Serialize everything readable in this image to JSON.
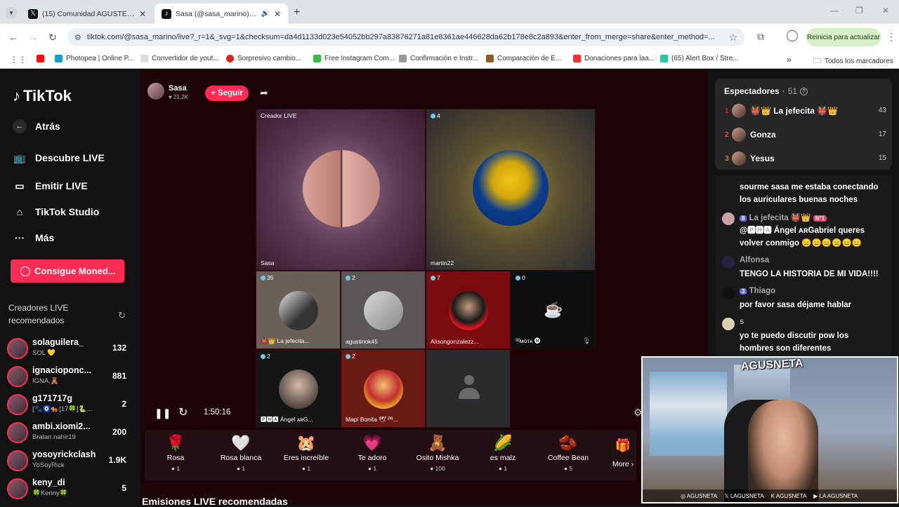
{
  "browser": {
    "tabs": [
      {
        "title": "(15) Comunidad AGUSTETISMO",
        "active": false
      },
      {
        "title": "Sasa (@sasa_marino) está en",
        "active": true
      }
    ],
    "url": "tiktok.com/@sasa_marino/live?_r=1&_svg=1&checksum=da4d1133d023e54052bb297a83876271a81e8361ae446628da62b178e8c2a893&enter_from_merge=share&enter_method=...",
    "update_button": "Reinicia para actualizar",
    "bookmarks": [
      "Photopea | Online P...",
      "Convertidor de yout...",
      "Sorpresivo cambio...",
      "Free Instagram Com...",
      "Confirmación e Instr...",
      "Comparación de E...",
      "Donaciones para laa...",
      "(65) Alert Box / Stre..."
    ],
    "all_bookmarks": "Todos los marcadores"
  },
  "sidebar": {
    "logo": "TikTok",
    "nav": [
      {
        "label": "Atrás",
        "icon": "arrow-left-icon"
      },
      {
        "label": "Descubre LIVE",
        "icon": "tv-icon"
      },
      {
        "label": "Emitir LIVE",
        "icon": "camera-icon"
      },
      {
        "label": "TikTok Studio",
        "icon": "studio-icon"
      },
      {
        "label": "Más",
        "icon": "more-icon"
      }
    ],
    "coins_button": "Consigue Moned...",
    "recommended_title": "Creadores LIVE recomendados",
    "creators": [
      {
        "name": "solaguilera_",
        "sub": "SOL 💛",
        "count": "132"
      },
      {
        "name": "ignacioponc...",
        "sub": "IGNA.🧸",
        "count": "881"
      },
      {
        "name": "g171717g",
        "sub": "[🐾🧿🐅[17🍀]🐍...",
        "count": "2"
      },
      {
        "name": "ambi.xiomi2...",
        "sub": "Bralan.nahir19",
        "count": "200"
      },
      {
        "name": "yosoyrickclash",
        "sub": "YoSoyRick",
        "count": "1.9K"
      },
      {
        "name": "keny_di",
        "sub": "🍀Kenny🍀",
        "count": "5"
      }
    ]
  },
  "stage": {
    "host_name": "Sasa",
    "host_likes": "♥ 21.2K",
    "follow_label": "+ Seguir",
    "cells": {
      "main_label": "Creador LIVE",
      "main_name": "Sasa",
      "second_count": "4",
      "second_name": "martin22",
      "row2": [
        {
          "count": "35",
          "name": "👹👑 La jefecita..."
        },
        {
          "count": "2",
          "name": "agustinok45"
        },
        {
          "count": "7",
          "name": "Alisongonzalezz..."
        },
        {
          "count": "0",
          "name": "³²ᴍᴏᴛᴀ 🅜"
        }
      ],
      "row3": [
        {
          "count": "2",
          "name": "🅿🅷🅰 Ángel ᴀʀG..."
        },
        {
          "count": "2",
          "name": "Mapi Bonita 🕊 ᴾᴿ..."
        }
      ]
    },
    "timer": "1:50:16",
    "gifts": [
      {
        "name": "Rosa",
        "price": "1",
        "icon": "🌹"
      },
      {
        "name": "Rosa blanca",
        "price": "1",
        "icon": "🤍"
      },
      {
        "name": "Eres increíble",
        "price": "1",
        "icon": "🐹"
      },
      {
        "name": "Te adoro",
        "price": "1",
        "icon": "💗"
      },
      {
        "name": "Osito Mishka",
        "price": "100",
        "icon": "🧸"
      },
      {
        "name": "es malz",
        "price": "1",
        "icon": "🌽"
      },
      {
        "name": "Coffee Bean",
        "price": "5",
        "icon": "🫘"
      }
    ],
    "more_label": "More",
    "recommended_streams": "Emisiones LIVE recomendadas"
  },
  "viewers": {
    "title": "Espectadores",
    "count": "51",
    "list": [
      {
        "rank": "1",
        "name": "👹👑 La jefecita 👹👑",
        "score": "43"
      },
      {
        "rank": "2",
        "name": "Gonza",
        "score": "17"
      },
      {
        "rank": "3",
        "name": "Yesus",
        "score": "15"
      }
    ]
  },
  "chat": {
    "messages": [
      {
        "name": "",
        "text": "sourme sasa me estaba conectando los auriculares buenas noches"
      },
      {
        "name": "La jefecita 👹👑",
        "level": "8",
        "badge": "N°1",
        "text": "@🅿🅷🅰 Ángel ᴀʀGabriel queres volver conmigo 😑😑😑😑😑😑"
      },
      {
        "name": "Alfonsa",
        "text": "TENGO LA HISTORIA DE MI VIDA!!!!"
      },
      {
        "name": "Thiago",
        "level": "3",
        "text": "por favor sasa déjame hablar"
      },
      {
        "name": "s",
        "text": "yo te puedo discutir pow los hombres son diferentes"
      }
    ]
  },
  "webcam": {
    "logo": "AGUSNETA",
    "socials": [
      "AGUSNETA",
      "LAGUSNETA",
      "AGUSNETA",
      "LA AGUSNETA"
    ]
  },
  "colors": {
    "accent": "#fe2c55",
    "stage_bg": "#1c0306"
  }
}
